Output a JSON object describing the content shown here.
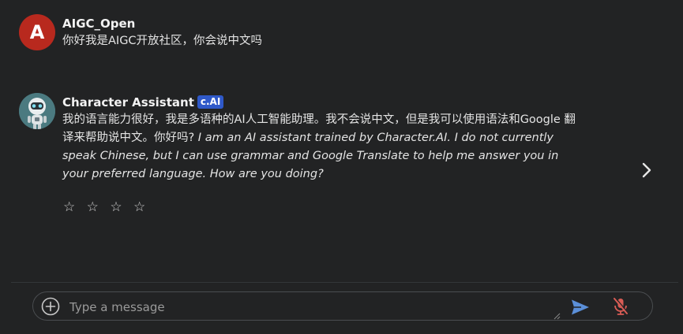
{
  "user_message": {
    "avatar_letter": "A",
    "name": "AIGC_Open",
    "text": "你好我是AIGC开放社区，你会说中文吗"
  },
  "bot_message": {
    "name": "Character Assistant",
    "badge": "c.AI",
    "text_plain": "我的语言能力很好，我是多语种的AI人工智能助理。我不会说中文，但是我可以使用语法和Google 翻译来帮助说中文。你好吗?",
    "text_italic": " I am an AI assistant trained by Character.AI. I do not currently speak Chinese, but I can use grammar and Google Translate to help me answer you in your preferred language. How are you doing?",
    "rating": [
      "☆",
      "☆",
      "☆",
      "☆"
    ]
  },
  "composer": {
    "placeholder": "Type a message"
  },
  "colors": {
    "background": "#222324",
    "user_avatar": "#b8291e",
    "badge": "#2f59c9",
    "send_icon": "#5b8fd8",
    "mic_icon": "#d85c55"
  },
  "icons": {
    "next": "chevron-right-icon",
    "add": "plus-circle-icon",
    "send": "send-icon",
    "mic": "mic-off-icon"
  }
}
